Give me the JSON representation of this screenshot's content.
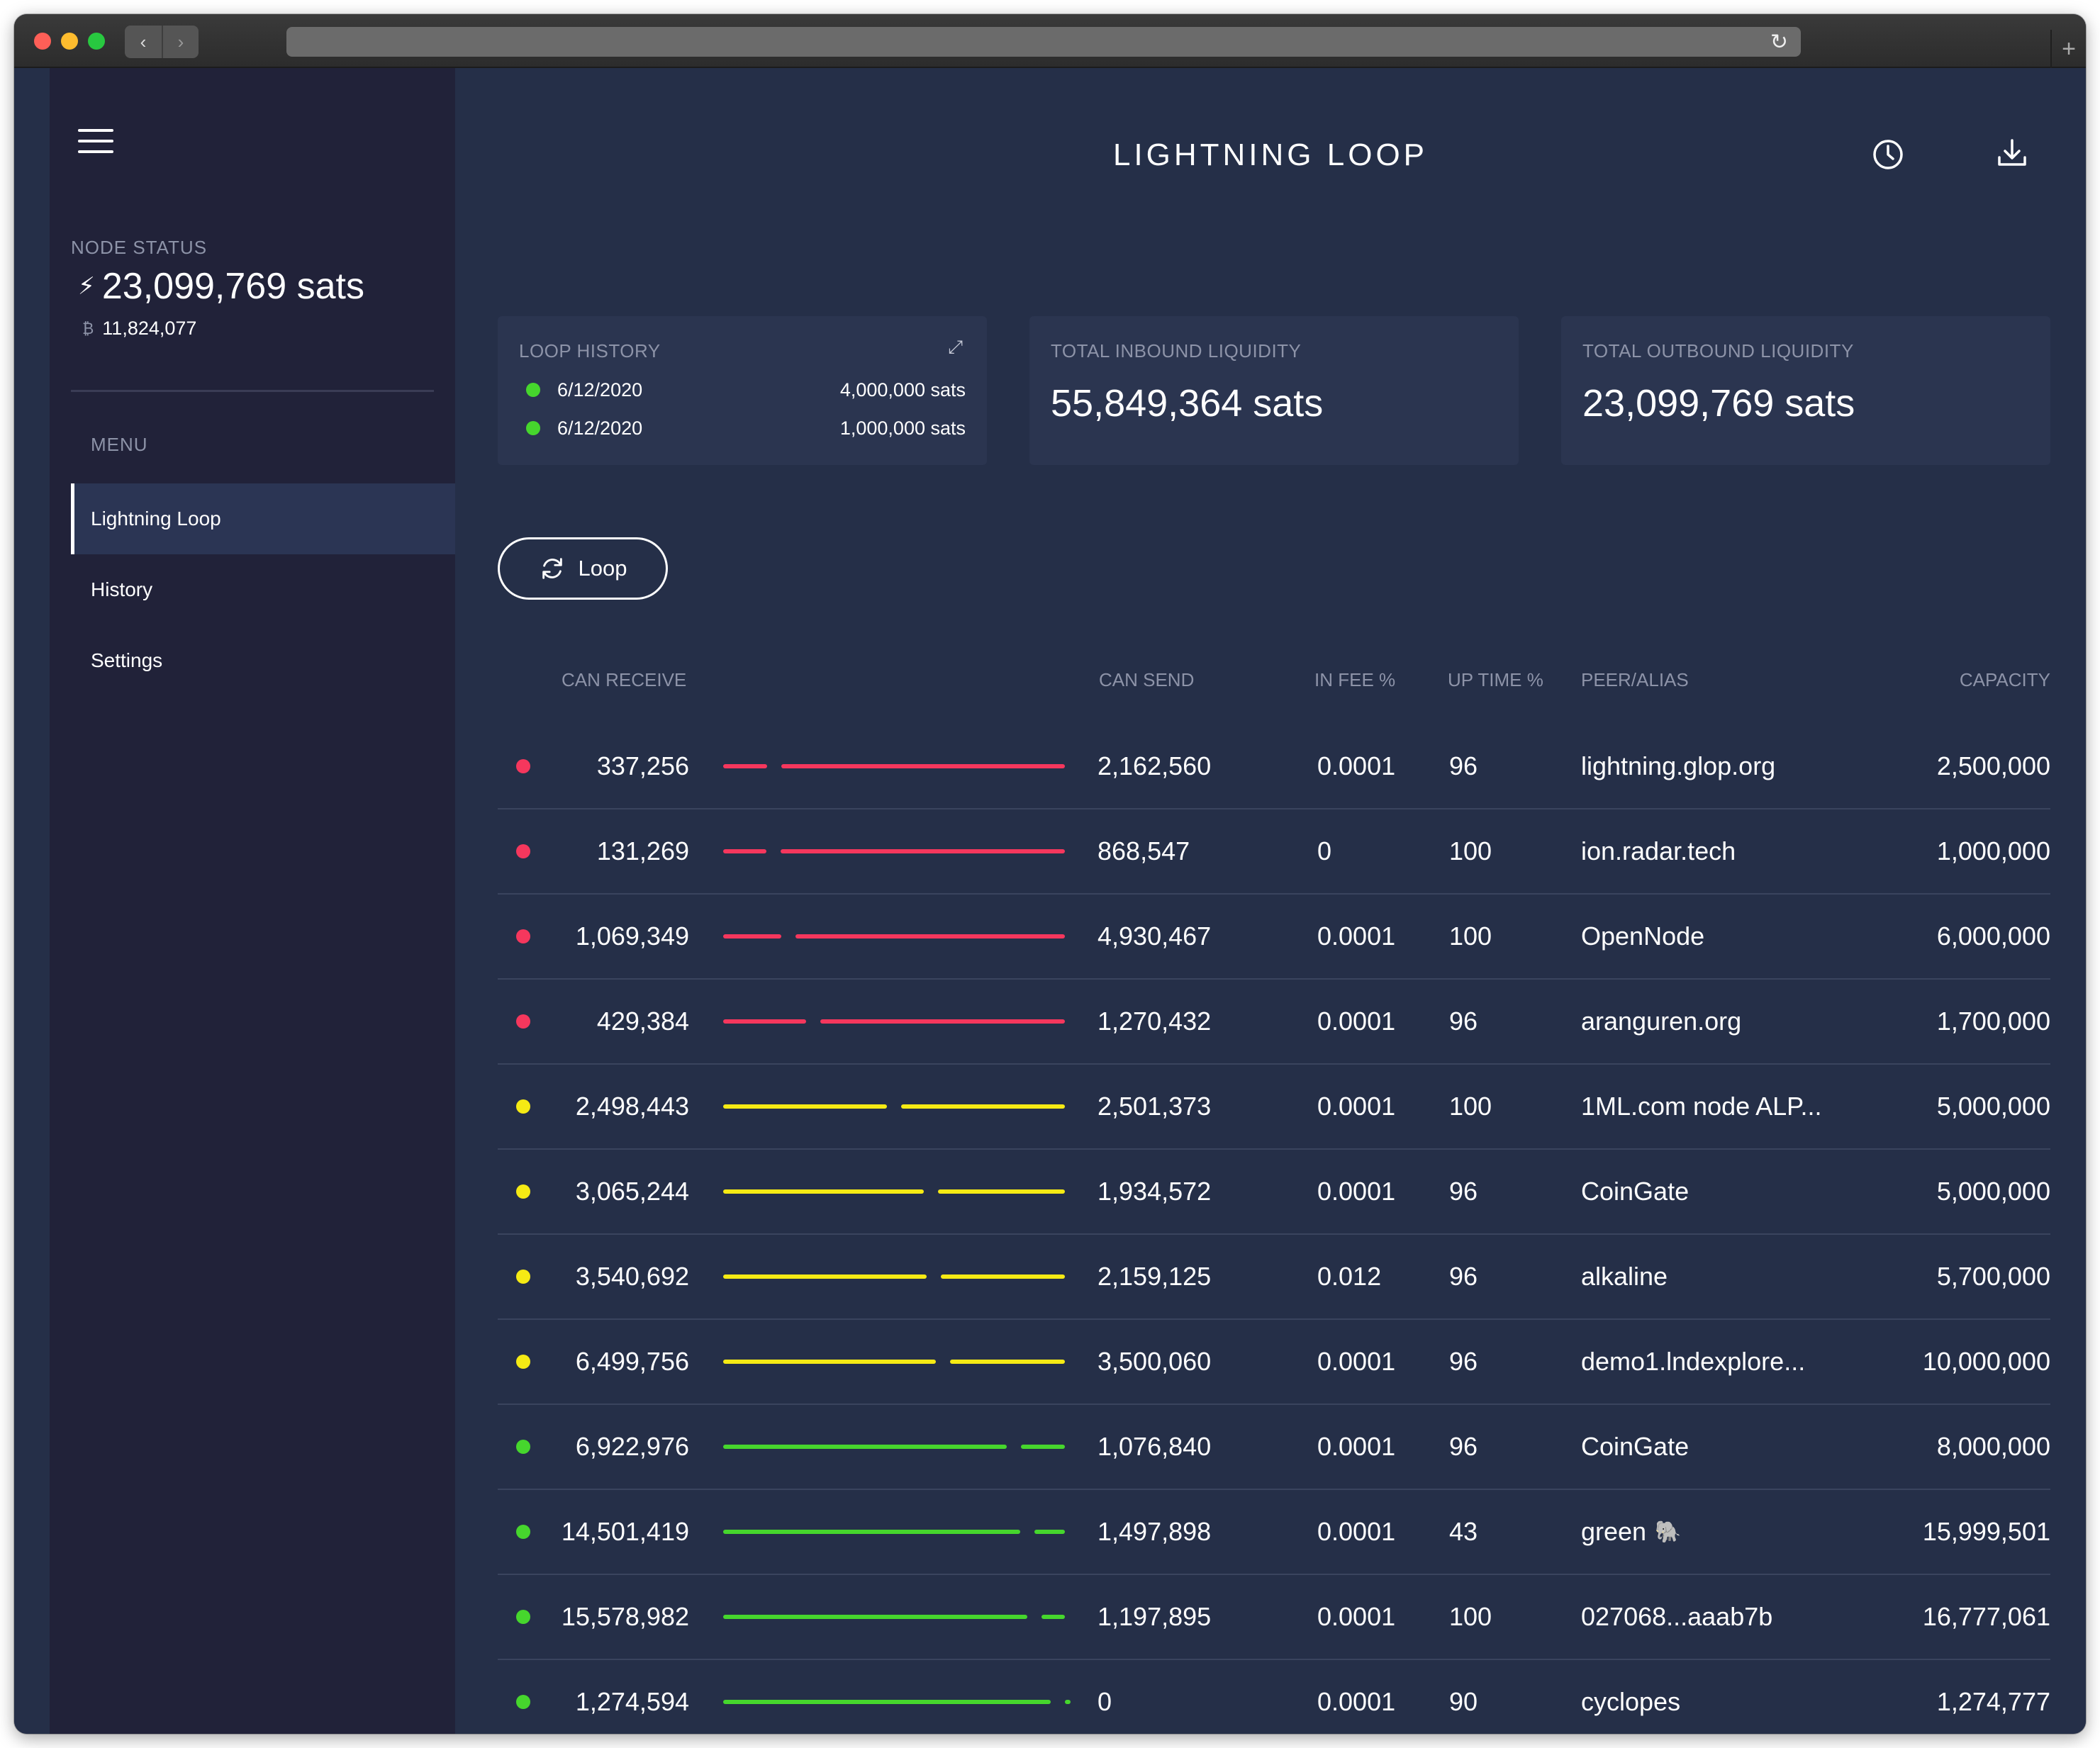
{
  "app": {
    "title": "LIGHTNING LOOP"
  },
  "sidebar": {
    "node_status_label": "NODE STATUS",
    "balance": "23,099,769 sats",
    "btc_balance": "11,824,077",
    "menu_label": "MENU",
    "items": [
      {
        "label": "Lightning Loop",
        "active": true
      },
      {
        "label": "History",
        "active": false
      },
      {
        "label": "Settings",
        "active": false
      }
    ]
  },
  "tiles": {
    "loop_history": {
      "label": "LOOP HISTORY",
      "entries": [
        {
          "date": "6/12/2020",
          "amount": "4,000,000 sats",
          "status_color": "#46d62d"
        },
        {
          "date": "6/12/2020",
          "amount": "1,000,000 sats",
          "status_color": "#46d62d"
        }
      ]
    },
    "inbound": {
      "label": "TOTAL INBOUND LIQUIDITY",
      "value": "55,849,364 sats"
    },
    "outbound": {
      "label": "TOTAL OUTBOUND LIQUIDITY",
      "value": "23,099,769 sats"
    }
  },
  "loop_button": {
    "label": "Loop"
  },
  "table": {
    "headers": {
      "can_receive": "CAN RECEIVE",
      "can_send": "CAN SEND",
      "in_fee": "IN FEE %",
      "up_time": "UP TIME %",
      "peer": "PEER/ALIAS",
      "capacity": "CAPACITY"
    },
    "status_colors": {
      "red": "#f5375d",
      "yellow": "#f5ea14",
      "green": "#46d62d"
    },
    "rows": [
      {
        "status": "red",
        "can_receive": "337,256",
        "receive_ratio": 0.135,
        "can_send": "2,162,560",
        "in_fee": "0.0001",
        "up_time": "96",
        "peer": "lightning.glop.org",
        "capacity": "2,500,000"
      },
      {
        "status": "red",
        "can_receive": "131,269",
        "receive_ratio": 0.131,
        "can_send": "868,547",
        "in_fee": "0",
        "up_time": "100",
        "peer": "ion.radar.tech",
        "capacity": "1,000,000"
      },
      {
        "status": "red",
        "can_receive": "1,069,349",
        "receive_ratio": 0.178,
        "can_send": "4,930,467",
        "in_fee": "0.0001",
        "up_time": "100",
        "peer": "OpenNode",
        "capacity": "6,000,000"
      },
      {
        "status": "red",
        "can_receive": "429,384",
        "receive_ratio": 0.253,
        "can_send": "1,270,432",
        "in_fee": "0.0001",
        "up_time": "96",
        "peer": "aranguren.org",
        "capacity": "1,700,000"
      },
      {
        "status": "yellow",
        "can_receive": "2,498,443",
        "receive_ratio": 0.5,
        "can_send": "2,501,373",
        "in_fee": "0.0001",
        "up_time": "100",
        "peer": "1ML.com node ALP...",
        "capacity": "5,000,000"
      },
      {
        "status": "yellow",
        "can_receive": "3,065,244",
        "receive_ratio": 0.613,
        "can_send": "1,934,572",
        "in_fee": "0.0001",
        "up_time": "96",
        "peer": "CoinGate",
        "capacity": "5,000,000"
      },
      {
        "status": "yellow",
        "can_receive": "3,540,692",
        "receive_ratio": 0.621,
        "can_send": "2,159,125",
        "in_fee": "0.012",
        "up_time": "96",
        "peer": "alkaline",
        "capacity": "5,700,000"
      },
      {
        "status": "yellow",
        "can_receive": "6,499,756",
        "receive_ratio": 0.65,
        "can_send": "3,500,060",
        "in_fee": "0.0001",
        "up_time": "96",
        "peer": "demo1.lndexplore...",
        "capacity": "10,000,000"
      },
      {
        "status": "green",
        "can_receive": "6,922,976",
        "receive_ratio": 0.865,
        "can_send": "1,076,840",
        "in_fee": "0.0001",
        "up_time": "96",
        "peer": "CoinGate",
        "capacity": "8,000,000"
      },
      {
        "status": "green",
        "can_receive": "14,501,419",
        "receive_ratio": 0.906,
        "can_send": "1,497,898",
        "in_fee": "0.0001",
        "up_time": "43",
        "peer": "green",
        "peer_emoji": "🐘",
        "capacity": "15,999,501"
      },
      {
        "status": "green",
        "can_receive": "15,578,982",
        "receive_ratio": 0.929,
        "can_send": "1,197,895",
        "in_fee": "0.0001",
        "up_time": "100",
        "peer": "027068...aaab7b",
        "capacity": "16,777,061"
      },
      {
        "status": "green",
        "can_receive": "1,274,594",
        "receive_ratio": 1.0,
        "can_send": "0",
        "in_fee": "0.0001",
        "up_time": "90",
        "peer": "cyclopes",
        "capacity": "1,274,777"
      }
    ]
  }
}
